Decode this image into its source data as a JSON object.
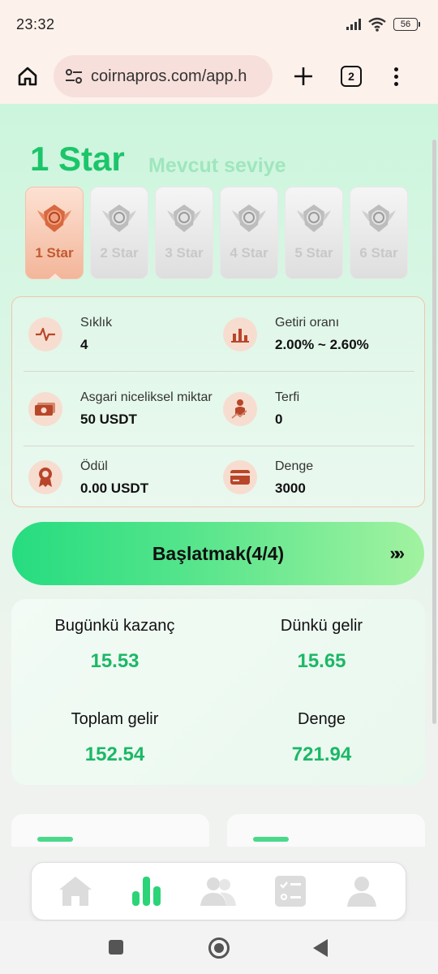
{
  "status_bar": {
    "time": "23:32",
    "battery": "56"
  },
  "browser": {
    "url": "coirnapros.com/app.h",
    "tab_count": "2"
  },
  "level": {
    "title": "1 Star",
    "subtitle": "Mevcut seviye"
  },
  "stars": [
    {
      "label": "1 Star",
      "active": true
    },
    {
      "label": "2 Star",
      "active": false
    },
    {
      "label": "3 Star",
      "active": false
    },
    {
      "label": "4 Star",
      "active": false
    },
    {
      "label": "5 Star",
      "active": false
    },
    {
      "label": "6 Star",
      "active": false
    }
  ],
  "info": {
    "frequency": {
      "label": "Sıklık",
      "value": "4",
      "icon": "pulse-icon"
    },
    "return_rate": {
      "label": "Getiri oranı",
      "value": "2.00% ~ 2.60%",
      "icon": "bar-chart-icon"
    },
    "min_amount": {
      "label": "Asgari niceliksel miktar",
      "value": "50 USDT",
      "icon": "cash-icon"
    },
    "promotion": {
      "label": "Terfi",
      "value": "0",
      "icon": "growth-person-icon"
    },
    "reward": {
      "label": "Ödül",
      "value": "0.00 USDT",
      "icon": "medal-icon"
    },
    "balance": {
      "label": "Denge",
      "value": "3000",
      "icon": "card-icon"
    }
  },
  "start_button": {
    "label": "Başlatmak(4/4)",
    "arrows": "»»"
  },
  "earnings": {
    "today": {
      "label": "Bugünkü kazanç",
      "value": "15.53"
    },
    "yesterday": {
      "label": "Dünkü gelir",
      "value": "15.65"
    },
    "total": {
      "label": "Toplam gelir",
      "value": "152.54"
    },
    "balance": {
      "label": "Denge",
      "value": "721.94"
    }
  },
  "bottom_nav": [
    "home-icon",
    "chart-icon",
    "team-icon",
    "tasks-icon",
    "profile-icon"
  ],
  "colors": {
    "accent_green": "#1cc56a",
    "accent_orange": "#c25a31",
    "icon_bg": "#f7ddd0"
  }
}
